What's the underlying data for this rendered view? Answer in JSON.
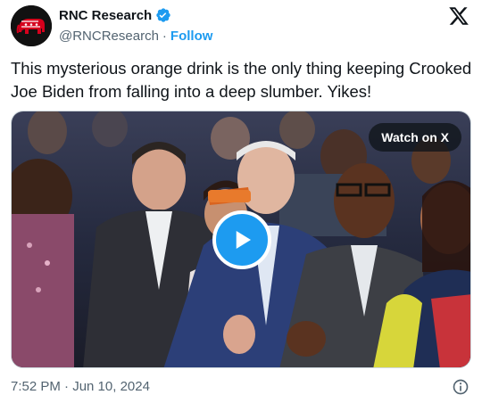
{
  "account": {
    "name": "RNC Research",
    "handle": "@RNCResearch",
    "separator": "·",
    "follow_label": "Follow",
    "avatar_icon": "gop-elephant-logo",
    "verified_icon": "verified-badge-icon",
    "brand_color": "#1d9bf0"
  },
  "tweet": {
    "text": "This mysterious orange drink is the only thing keeping Crooked Joe Biden from falling into a deep slumber. Yikes!",
    "timestamp": "7:52 PM · Jun 10, 2024"
  },
  "media": {
    "type": "video",
    "watch_label": "Watch on X",
    "play_icon": "play-icon"
  },
  "icons": {
    "platform": "x-logo-icon",
    "info": "info-icon"
  }
}
